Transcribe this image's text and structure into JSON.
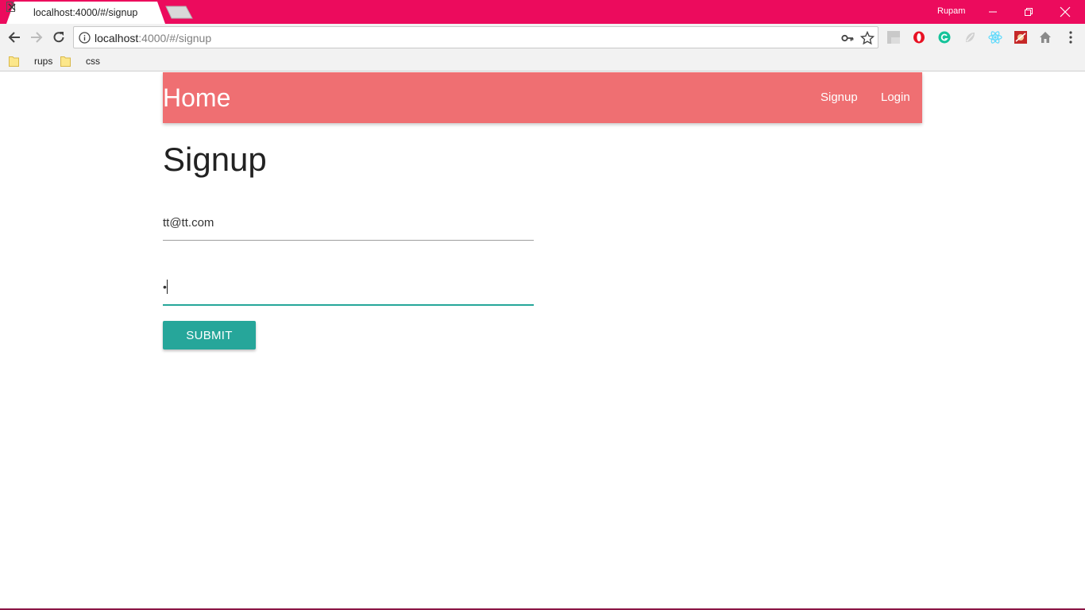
{
  "browser": {
    "tab_title": "localhost:4000/#/signup",
    "profile_name": "Rupam",
    "url_host": "localhost",
    "url_rest": ":4000/#/signup",
    "accent_color": "#ec0b5d"
  },
  "bookmarks": [
    {
      "label": "rups"
    },
    {
      "label": "css"
    }
  ],
  "navbar": {
    "brand": "Home",
    "links": [
      {
        "label": "Signup"
      },
      {
        "label": "Login"
      }
    ],
    "color": "#ef6f72"
  },
  "form": {
    "heading": "Signup",
    "email_value": "tt@tt.com",
    "password_value": "•",
    "submit_label": "SUBMIT",
    "accent_color": "#26a69a"
  }
}
